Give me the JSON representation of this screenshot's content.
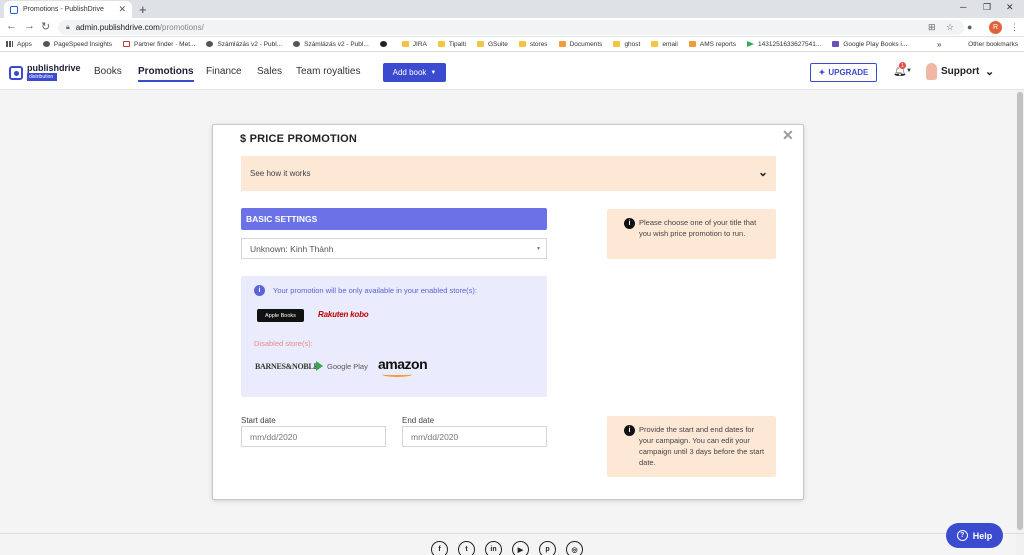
{
  "browser": {
    "tab_title": "Promotions - PublishDrive",
    "url_host": "admin.publishdrive.com",
    "url_path": "/promotions/",
    "profile_initial": "R",
    "bookmarks": [
      {
        "label": "Apps",
        "icon": "apps-icon"
      },
      {
        "label": "PageSpeed Insights",
        "icon": "pagespeed-icon"
      },
      {
        "label": "Partner finder · Met...",
        "icon": "gmail-icon"
      },
      {
        "label": "Számlázás v2 - Publ...",
        "icon": "globe-icon"
      },
      {
        "label": "Számlázás v2 - Publ...",
        "icon": "globe-icon"
      },
      {
        "label": "",
        "icon": "github-icon"
      },
      {
        "label": "JIRA",
        "icon": "folder-icon"
      },
      {
        "label": "Tipalti",
        "icon": "folder-icon"
      },
      {
        "label": "GSuite",
        "icon": "folder-icon"
      },
      {
        "label": "stores",
        "icon": "folder-icon"
      },
      {
        "label": "Documents",
        "icon": "documents-icon"
      },
      {
        "label": "ghost",
        "icon": "folder-icon"
      },
      {
        "label": "email",
        "icon": "folder-icon"
      },
      {
        "label": "AMS reports",
        "icon": "ams-icon"
      },
      {
        "label": "1431251633627541...",
        "icon": "play-icon"
      },
      {
        "label": "Google Play Books i...",
        "icon": "playbooks-icon"
      }
    ],
    "other_bookmarks": "Other bookmarks"
  },
  "header": {
    "logo_text": "publishdrive",
    "logo_sub": "distribution",
    "nav": [
      "Books",
      "Promotions",
      "Finance",
      "Sales",
      "Team royalties"
    ],
    "active_nav": "Promotions",
    "add_book_label": "Add book",
    "upgrade_label": "UPGRADE",
    "notification_count": "1",
    "support_label": "Support"
  },
  "modal": {
    "title": "$ PRICE PROMOTION",
    "how_it_works": "See how it works",
    "basic_settings": "BASIC SETTINGS",
    "selected_title": "Unknown: Kinh Thánh",
    "enabled_info": "Your promotion will be only available in your enabled store(s):",
    "enabled_stores": [
      "Apple Books",
      "Rakuten kobo"
    ],
    "disabled_label": "Disabled store(s):",
    "disabled_stores": [
      "BARNES&NOBLE",
      "Google Play",
      "amazon"
    ],
    "start_date_label": "Start date",
    "start_date_placeholder": "mm/dd/2020",
    "end_date_label": "End date",
    "end_date_placeholder": "mm/dd/2020",
    "tip_title": "Please choose one of your title that you wish price promotion to run.",
    "tip_dates": "Provide the start and end dates for your campaign. You can edit your campaign until 3 days before the start date."
  },
  "footer": {
    "social": [
      "facebook-icon",
      "twitter-icon",
      "linkedin-icon",
      "youtube-icon",
      "pinterest-icon",
      "instagram-icon"
    ],
    "help_label": "Help"
  }
}
